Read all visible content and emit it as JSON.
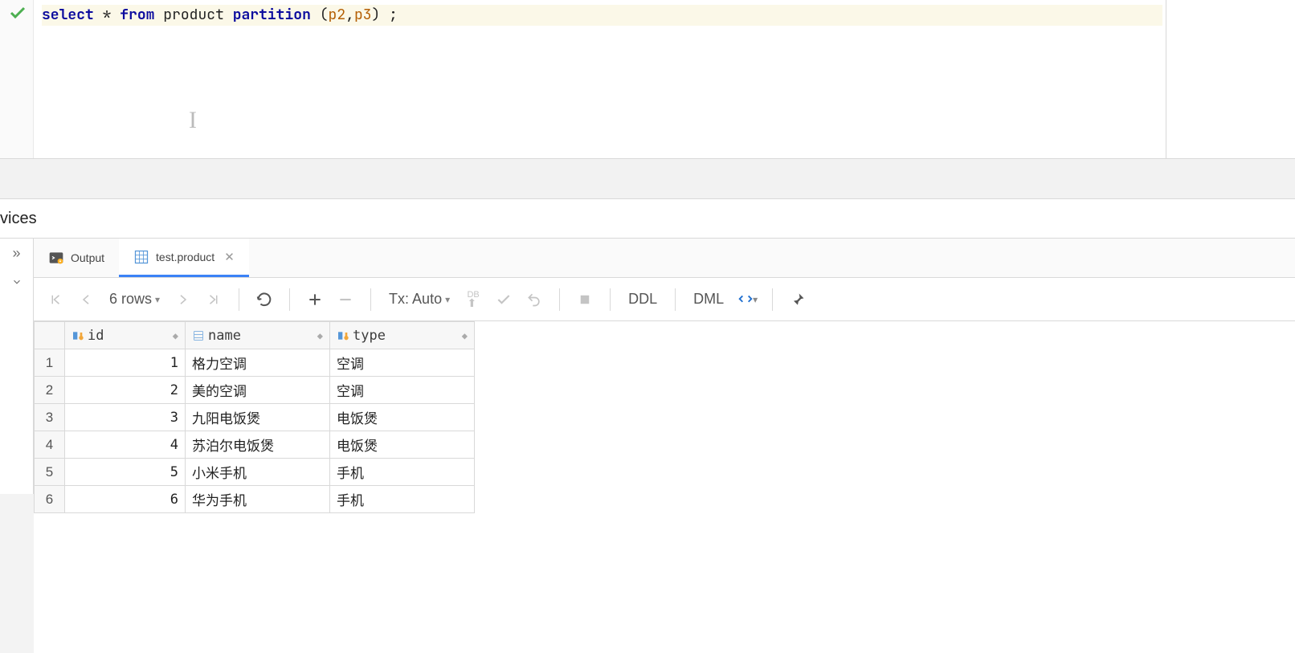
{
  "sql": {
    "tokens": [
      {
        "t": "select",
        "c": "kw"
      },
      {
        "t": " ",
        "c": "sp"
      },
      {
        "t": "*",
        "c": "op"
      },
      {
        "t": " ",
        "c": "sp"
      },
      {
        "t": "from",
        "c": "kw"
      },
      {
        "t": " ",
        "c": "sp"
      },
      {
        "t": "product",
        "c": "id"
      },
      {
        "t": " ",
        "c": "sp"
      },
      {
        "t": "partition",
        "c": "kw"
      },
      {
        "t": " ",
        "c": "sp"
      },
      {
        "t": "(",
        "c": "op"
      },
      {
        "t": "p2",
        "c": "nm"
      },
      {
        "t": ",",
        "c": "op"
      },
      {
        "t": "p3",
        "c": "nm"
      },
      {
        "t": ")",
        "c": "op"
      },
      {
        "t": " ",
        "c": "sp"
      },
      {
        "t": ";",
        "c": "op"
      }
    ]
  },
  "panel": {
    "title_fragment": "vices"
  },
  "tabs": {
    "output": "Output",
    "result": "test.product"
  },
  "toolbar": {
    "rows_label": "6 rows",
    "tx_label": "Tx: Auto",
    "db_label": "DB",
    "ddl_label": "DDL",
    "dml_label": "DML"
  },
  "columns": [
    {
      "key": "id",
      "label": "id",
      "pk": true
    },
    {
      "key": "name",
      "label": "name",
      "pk": false
    },
    {
      "key": "type",
      "label": "type",
      "pk": true
    }
  ],
  "rows": [
    {
      "n": "1",
      "id": "1",
      "name": "格力空调",
      "type": "空调"
    },
    {
      "n": "2",
      "id": "2",
      "name": "美的空调",
      "type": "空调"
    },
    {
      "n": "3",
      "id": "3",
      "name": "九阳电饭煲",
      "type": "电饭煲"
    },
    {
      "n": "4",
      "id": "4",
      "name": "苏泊尔电饭煲",
      "type": "电饭煲"
    },
    {
      "n": "5",
      "id": "5",
      "name": "小米手机",
      "type": "手机"
    },
    {
      "n": "6",
      "id": "6",
      "name": "华为手机",
      "type": "手机"
    }
  ]
}
